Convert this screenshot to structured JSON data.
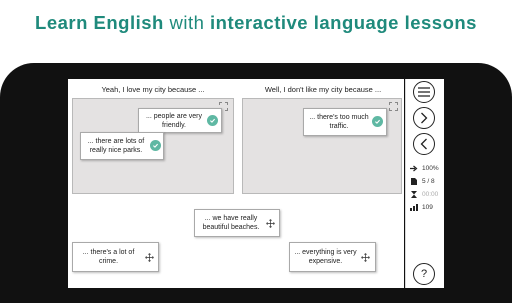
{
  "headline": {
    "part1": "Learn English",
    "part2": "with",
    "part3": "interactive language lessons"
  },
  "zones": [
    {
      "title": "Yeah, I love my city because ..."
    },
    {
      "title": "Well, I don't like my city because ..."
    }
  ],
  "placed_cards": [
    {
      "text_line1": "... people are very",
      "text_line2": "friendly."
    },
    {
      "text_line1": "... there are lots of",
      "text_line2": "really nice parks."
    },
    {
      "text_line1": "... there's too much",
      "text_line2": "traffic."
    }
  ],
  "loose_cards": [
    {
      "text_line1": "... we have really",
      "text_line2": "beautiful beaches."
    },
    {
      "text_line1": "... there's a lot of",
      "text_line2": "crime."
    },
    {
      "text_line1": "... everything is very",
      "text_line2": "expensive."
    }
  ],
  "sidebar": {
    "zoom": "100%",
    "page": "5 / 8",
    "timer": "00:00",
    "score": "109",
    "help": "?"
  },
  "colors": {
    "accent": "#1f8a7c",
    "check": "#5fb8a3"
  },
  "icons": [
    "menu-icon",
    "next-icon",
    "back-icon",
    "zoom-icon",
    "page-icon",
    "timer-icon",
    "score-icon",
    "check-icon",
    "move-icon",
    "help-icon"
  ]
}
